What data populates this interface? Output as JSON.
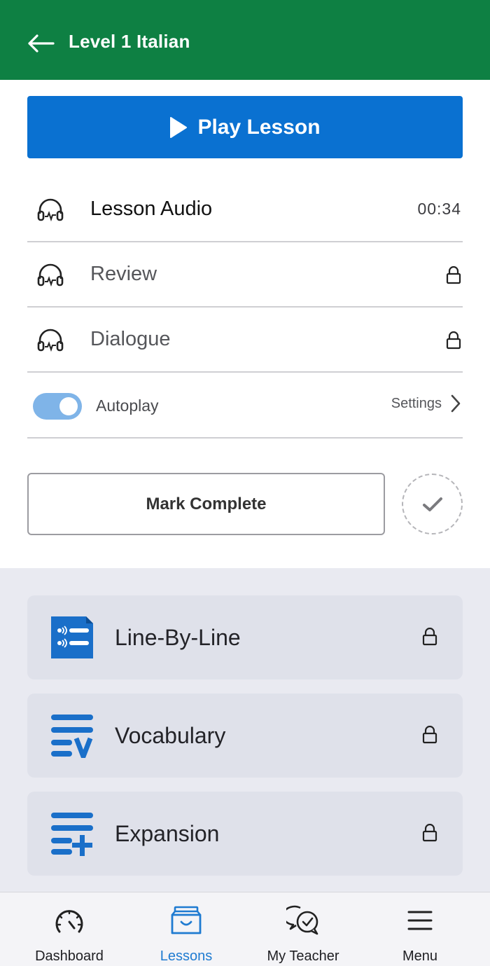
{
  "header": {
    "title": "Level 1 Italian",
    "back_icon": "arrow-left-icon"
  },
  "play_button": {
    "label": "Play Lesson",
    "icon": "play-icon"
  },
  "tracks": [
    {
      "label": "Lesson Audio",
      "icon": "headphones-icon",
      "duration": "00:34",
      "locked": false
    },
    {
      "label": "Review",
      "icon": "headphones-icon",
      "locked": true
    },
    {
      "label": "Dialogue",
      "icon": "headphones-icon",
      "locked": true
    }
  ],
  "autoplay": {
    "label": "Autoplay",
    "enabled": true,
    "settings_label": "Settings"
  },
  "mark_complete": {
    "label": "Mark Complete"
  },
  "cards": [
    {
      "label": "Line-By-Line",
      "icon": "line-by-line-icon",
      "locked": true
    },
    {
      "label": "Vocabulary",
      "icon": "vocabulary-icon",
      "locked": true
    },
    {
      "label": "Expansion",
      "icon": "expansion-icon",
      "locked": true
    }
  ],
  "tabs": [
    {
      "label": "Dashboard",
      "icon": "dashboard-gauge-icon",
      "active": false
    },
    {
      "label": "Lessons",
      "icon": "lessons-box-icon",
      "active": true
    },
    {
      "label": "My Teacher",
      "icon": "chat-bubbles-icon",
      "active": false
    },
    {
      "label": "Menu",
      "icon": "hamburger-menu-icon",
      "active": false
    }
  ],
  "colors": {
    "header_green": "#0e8043",
    "primary_blue": "#0a71d1",
    "icon_blue": "#1a6fc9",
    "toggle_blue": "#7fb4e8",
    "active_tab": "#1f7bd1"
  }
}
